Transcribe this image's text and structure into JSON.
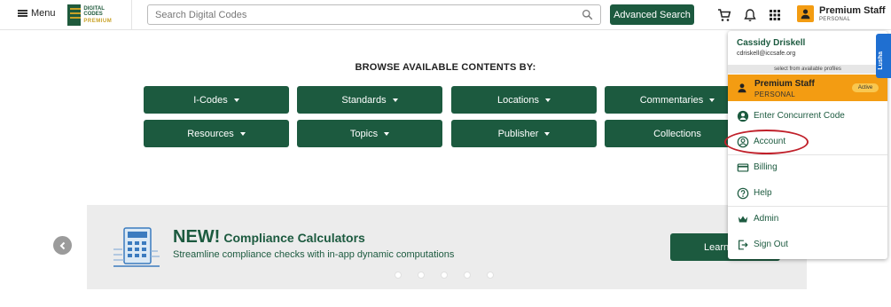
{
  "header": {
    "menu_label": "Menu",
    "logo_line1": "DIGITAL CODES",
    "logo_line2": "PREMIUM",
    "search_placeholder": "Search Digital Codes",
    "advanced_search_label": "Advanced Search",
    "profile_name": "Premium Staff",
    "profile_sub": "PERSONAL"
  },
  "browse": {
    "title": "BROWSE AVAILABLE CONTENTS BY:",
    "row1": [
      {
        "label": "I-Codes",
        "has_caret": true
      },
      {
        "label": "Standards",
        "has_caret": true
      },
      {
        "label": "Locations",
        "has_caret": true
      },
      {
        "label": "Commentaries",
        "has_caret": true
      }
    ],
    "row2": [
      {
        "label": "Resources",
        "has_caret": true
      },
      {
        "label": "Topics",
        "has_caret": true
      },
      {
        "label": "Publisher",
        "has_caret": true
      },
      {
        "label": "Collections",
        "has_caret": false
      }
    ]
  },
  "banner": {
    "title_new": "NEW!",
    "title_rest": "Compliance Calculators",
    "subtitle": "Streamline compliance checks with in-app dynamic computations",
    "button_label": "Learn",
    "dot_count": 5
  },
  "dropdown": {
    "user_name": "Cassidy Driskell",
    "user_email": "cdriskell@iccsafe.org",
    "select_label": "select from available profiles",
    "active_profile": {
      "name": "Premium Staff",
      "sub": "PERSONAL",
      "badge": "Active"
    },
    "items": [
      {
        "label": "Enter Concurrent Code",
        "icon": "user-circle-icon"
      },
      {
        "label": "Account",
        "icon": "account-circle-icon"
      },
      {
        "label": "Billing",
        "icon": "credit-card-icon"
      },
      {
        "label": "Help",
        "icon": "help-icon"
      },
      {
        "label": "Admin",
        "icon": "crown-icon"
      },
      {
        "label": "Sign Out",
        "icon": "sign-out-icon"
      }
    ]
  },
  "side_tab": {
    "label": "Lusha"
  },
  "colors": {
    "brand_green": "#1c5a3f",
    "accent_orange": "#f39c12",
    "highlight_red": "#c0202a"
  }
}
